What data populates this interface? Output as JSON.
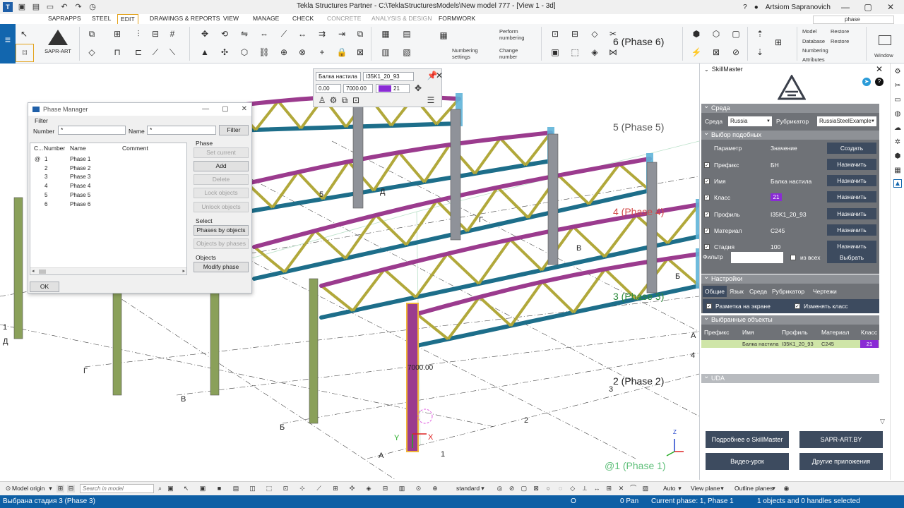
{
  "window": {
    "title": "Tekla Structures Partner  -  C:\\TeklaStructuresModels\\New model 777  -  [View 1 - 3d]",
    "user": "Artsiom Sapranovich",
    "help": "?"
  },
  "ribbon": {
    "tabs": [
      "SAPRAPPS",
      "STEEL",
      "EDIT",
      "DRAWINGS & REPORTS",
      "VIEW",
      "MANAGE",
      "CHECK",
      "CONCRETE",
      "ANALYSIS & DESIGN",
      "FORMWORK"
    ],
    "active_tab": "EDIT",
    "search_value": "phase",
    "sapr_label": "SAPR-ART",
    "numbering_settings": "Numbering settings",
    "perform_numbering": "Perform numbering",
    "change_number": "Change number",
    "model": "Model",
    "database": "Database",
    "numbering": "Numbering",
    "attributes": "Attributes",
    "restore1": "Restore",
    "restore2": "Restore",
    "window": "Window"
  },
  "phase_manager": {
    "title": "Phase Manager",
    "filter_label": "Filter",
    "number_label": "Number",
    "number_value": "*",
    "name_label": "Name",
    "name_value": "*",
    "filter_button": "Filter",
    "columns": [
      "C...",
      "Number",
      "Name",
      "Comment"
    ],
    "rows": [
      {
        "current": "@",
        "number": "1",
        "name": "Phase 1"
      },
      {
        "current": "",
        "number": "2",
        "name": "Phase 2"
      },
      {
        "current": "",
        "number": "3",
        "name": "Phase 3"
      },
      {
        "current": "",
        "number": "4",
        "name": "Phase 4"
      },
      {
        "current": "",
        "number": "5",
        "name": "Phase 5"
      },
      {
        "current": "",
        "number": "6",
        "name": "Phase 6"
      }
    ],
    "phase_group": "Phase",
    "set_current": "Set current",
    "add": "Add",
    "delete": "Delete",
    "lock_objects": "Lock objects",
    "unlock_objects": "Unlock objects",
    "select_group": "Select",
    "phases_by_objects": "Phases by objects",
    "objects_by_phases": "Objects by phases",
    "objects_group": "Objects",
    "modify_phase": "Modify phase",
    "ok": "OK"
  },
  "mini_toolbar": {
    "name": "Балка настила",
    "profile": "I35K1_20_93",
    "start": "0.00",
    "end": "7000.00",
    "class": "21"
  },
  "view": {
    "phase_labels": [
      "6 (Phase 6)",
      "5 (Phase 5)",
      "4 (Phase 4)",
      "3 (Phase 3)",
      "2 (Phase 2)",
      "@1 (Phase 1)"
    ],
    "dimension": "7000.00",
    "grid_letters": [
      "Д",
      "Г",
      "В",
      "Б",
      "А"
    ],
    "grid_numbers": [
      "1",
      "2",
      "3",
      "4",
      "5"
    ],
    "axis_x": "X",
    "axis_y": "Y",
    "axis_z": "Z"
  },
  "skillmaster": {
    "title": "SkillMaster",
    "section_env": "Среда",
    "env_label": "Среда",
    "env_value": "Russia",
    "rubricator_label": "Рубрикатор",
    "rubricator_value": "RussiaSteelExample",
    "section_similar": "Выбор подобных",
    "param_header": "Параметр",
    "value_header": "Значение",
    "create_button": "Создать",
    "params": [
      {
        "label": "Префикс",
        "value": "БН",
        "button": "Назначить"
      },
      {
        "label": "Имя",
        "value": "Балка настила",
        "button": "Назначить"
      },
      {
        "label": "Класс",
        "value": "21",
        "button": "Назначить"
      },
      {
        "label": "Профиль",
        "value": "I35K1_20_93",
        "button": "Назначить"
      },
      {
        "label": "Материал",
        "value": "C245",
        "button": "Назначить"
      },
      {
        "label": "Стадия",
        "value": "100",
        "button": "Назначить"
      }
    ],
    "filter_label": "Фильтр",
    "from_all": "из всех",
    "select_button": "Выбрать",
    "section_settings": "Настройки",
    "settings_tabs": [
      "Общие",
      "Язык",
      "Среда",
      "Рубрикатор",
      "Чертежи"
    ],
    "marking_on_screen": "Разметка на экране",
    "change_class": "Изменять класс",
    "section_selected": "Выбранные объекты",
    "sel_columns": [
      "Префикс",
      "Имя",
      "Профиль",
      "Материал",
      "Класс"
    ],
    "sel_row": {
      "prefix": "",
      "name": "Балка настила",
      "profile": "I35K1_20_93",
      "material": "C245",
      "class": "21"
    },
    "section_uda": "UDA",
    "btn_about": "Подробнее о SkillMaster",
    "btn_site": "SAPR-ART.BY",
    "btn_video": "Видео-урок",
    "btn_other": "Другие приложения"
  },
  "bottom": {
    "model_origin": "Model origin",
    "search_placeholder": "Search in model",
    "standard": "standard",
    "auto": "Auto",
    "view_plane": "View plane",
    "outline_planes": "Outline planes"
  },
  "status": {
    "left": "Выбрана стадия 3 (Phase 3)",
    "o": "O",
    "pan": "0 Pan",
    "current_phase": "Current phase: 1, Phase 1",
    "selected": "1 objects and 0 handles selected"
  },
  "colors": {
    "accent_blue": "#0e5fa5",
    "truss_top": "#9b3b8e",
    "truss_bottom": "#1d6e8a",
    "truss_web": "#b1a83a",
    "column": "#8aa05a",
    "sm_panel": "#6f7277",
    "sm_button": "#3d4b5f",
    "class_purple": "#8a2bd5"
  }
}
